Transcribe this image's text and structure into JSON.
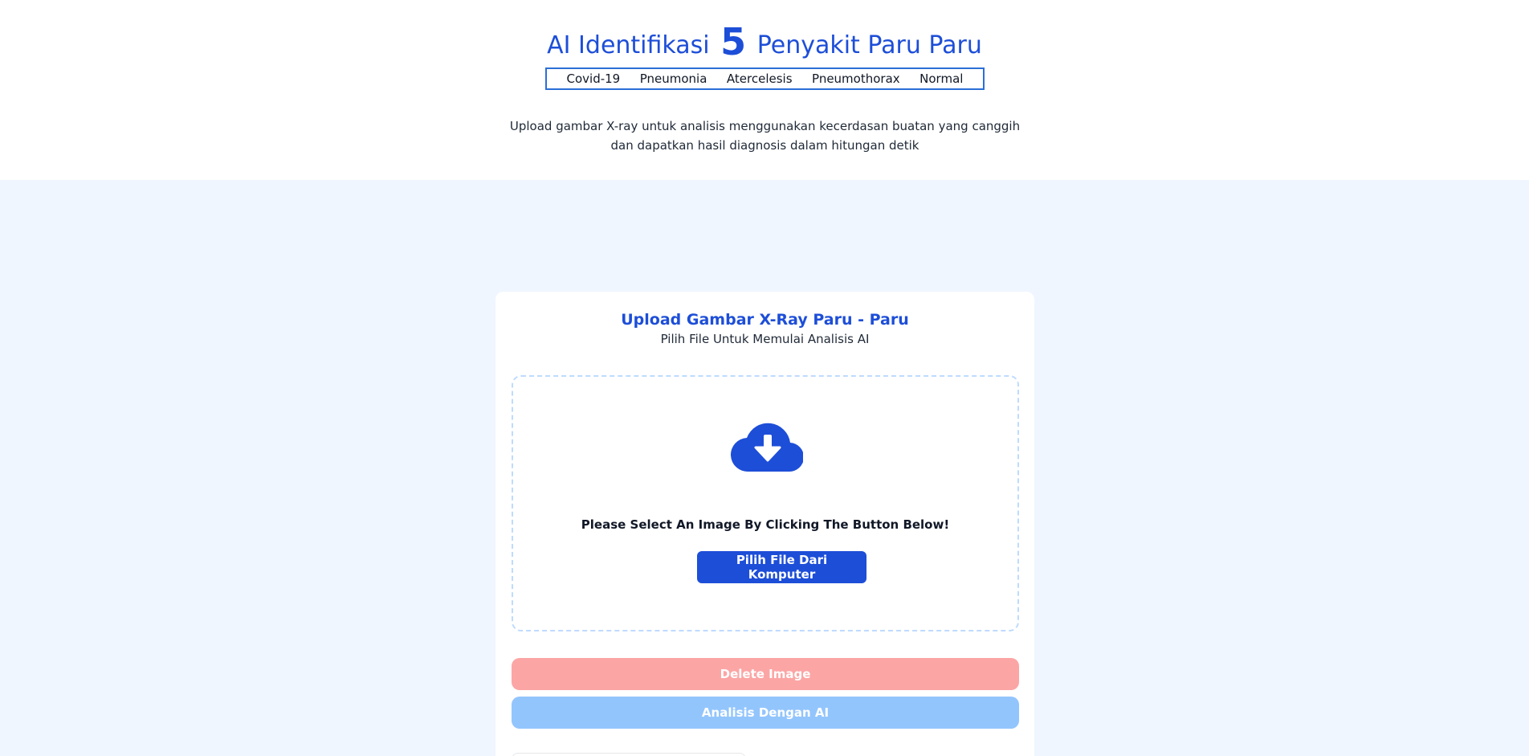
{
  "header": {
    "title_before": "AI Identifikasi",
    "title_number": "5",
    "title_after": "Penyakit Paru Paru",
    "diseases": [
      "Covid-19",
      "Pneumonia",
      "Atercelesis",
      "Pneumothorax",
      "Normal"
    ],
    "subtitle": "Upload gambar X-ray untuk analisis menggunakan kecerdasan buatan yang canggih dan dapatkan hasil diagnosis dalam hitungan detik"
  },
  "upload_card": {
    "title": "Upload Gambar X-Ray Paru - Paru",
    "subtitle": "Pilih File Untuk Memulai Analisis AI",
    "dropzone": {
      "icon": "cloud-download-icon",
      "instruction": "Please Select An Image By Clicking The Button Below!",
      "pick_button_label": "Pilih File Dari Komputer"
    },
    "delete_button_label": "Delete Image",
    "analyze_button_label": "Analisis Dengan AI"
  },
  "colors": {
    "accent": "#1d4ed8",
    "page_background": "#eff6ff",
    "delete_disabled": "#fca5a5",
    "analyze_disabled": "#93c5fd"
  }
}
